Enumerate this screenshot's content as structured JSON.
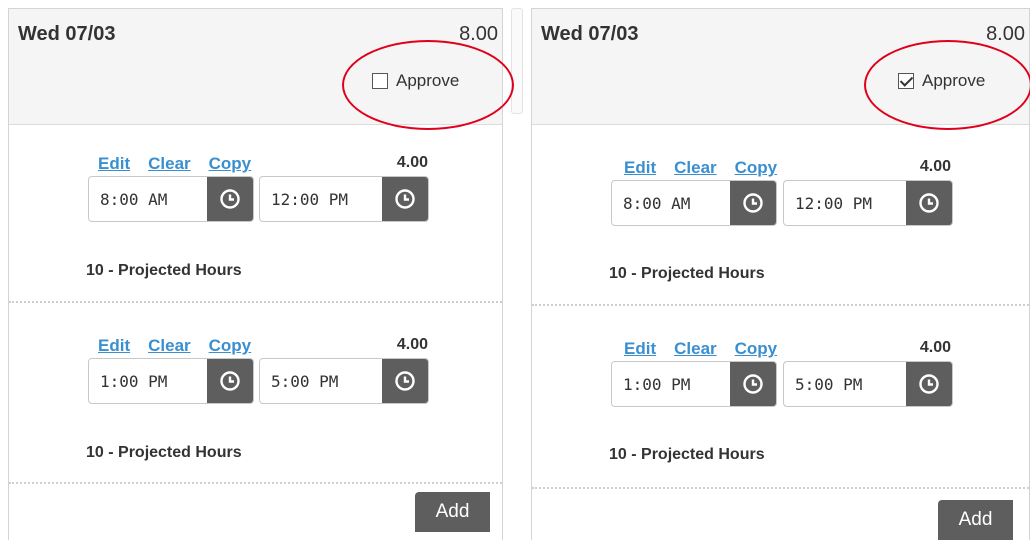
{
  "colors": {
    "accent_link": "#3a8fd0",
    "button_dark": "#5e5e5e",
    "highlight_ring": "#e0001b",
    "header_bg": "#f5f5f5"
  },
  "panels": [
    {
      "date": "Wed 07/03",
      "total": "8.00",
      "approve_label": "Approve",
      "approve_checked": false,
      "entries": [
        {
          "edit": "Edit",
          "clear": "Clear",
          "copy": "Copy",
          "hours": "4.00",
          "start": "8:00 AM",
          "end": "12:00 PM",
          "project": "10 - Projected Hours"
        },
        {
          "edit": "Edit",
          "clear": "Clear",
          "copy": "Copy",
          "hours": "4.00",
          "start": "1:00 PM",
          "end": "5:00 PM",
          "project": "10 - Projected Hours"
        }
      ],
      "add_label": "Add"
    },
    {
      "date": "Wed 07/03",
      "total": "8.00",
      "approve_label": "Approve",
      "approve_checked": true,
      "entries": [
        {
          "edit": "Edit",
          "clear": "Clear",
          "copy": "Copy",
          "hours": "4.00",
          "start": "8:00 AM",
          "end": "12:00 PM",
          "project": "10 - Projected Hours"
        },
        {
          "edit": "Edit",
          "clear": "Clear",
          "copy": "Copy",
          "hours": "4.00",
          "start": "1:00 PM",
          "end": "5:00 PM",
          "project": "10 - Projected Hours"
        }
      ],
      "add_label": "Add"
    }
  ],
  "icons": {
    "time_picker": "clock-icon",
    "approve": "checkbox-icon"
  }
}
